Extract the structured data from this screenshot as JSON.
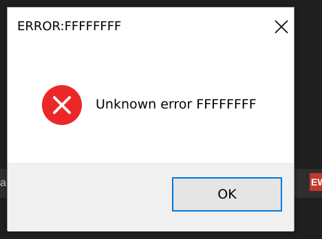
{
  "dialog": {
    "title": "ERROR:FFFFFFFF",
    "message": "Unknown error FFFFFFFF",
    "ok_label": "OK",
    "icon": "error-icon",
    "close_icon": "close-icon"
  },
  "background": {
    "left_fragment": "au",
    "right_fragment": "EW"
  },
  "colors": {
    "error_red": "#e81123",
    "accent_blue": "#0078d7",
    "footer_gray": "#f0f0f0",
    "button_gray": "#e5e5e5"
  }
}
